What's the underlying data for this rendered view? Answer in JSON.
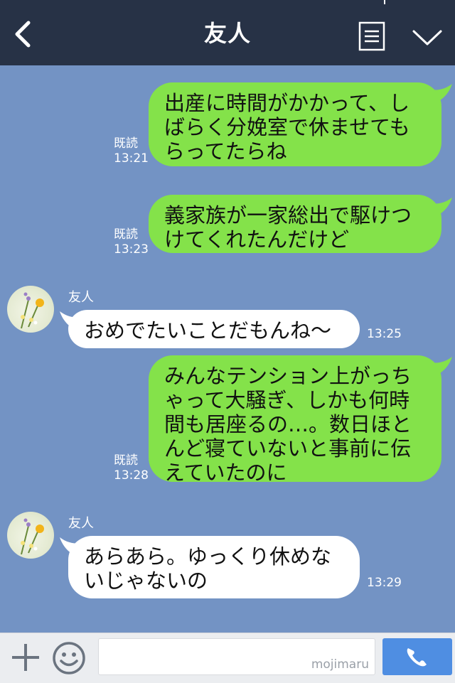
{
  "header": {
    "title": "友人",
    "back_icon": "chevron-left-icon",
    "menu_icon": "notes-icon",
    "expand_icon": "chevron-down-icon"
  },
  "messages": [
    {
      "from": "me",
      "text": "出産に時間がかかって、し\nばらく分娩室で休ませても\nらってたらね",
      "read": "既読",
      "time": "13:21"
    },
    {
      "from": "me",
      "text": "義家族が一家総出で駆けつ\nけてくれたんだけど",
      "read": "既読",
      "time": "13:23"
    },
    {
      "from": "friend",
      "sender": "友人",
      "text": "おめでたいことだもんね〜",
      "time": "13:25"
    },
    {
      "from": "me",
      "text": "みんなテンション上がっち\nゃって大騒ぎ、しかも何時\n間も居座るの…。数日ほと\nんど寝ていないと事前に伝\nえていたのに",
      "read": "既読",
      "time": "13:28"
    },
    {
      "from": "friend",
      "sender": "友人",
      "text": "あらあら。ゆっくり休めな\nいじゃないの",
      "time": "13:29"
    }
  ],
  "footer": {
    "input_value": "",
    "watermark": "mojimaru",
    "plus_icon": "plus-icon",
    "sticker_icon": "smiley-icon",
    "call_icon": "phone-icon"
  },
  "colors": {
    "header_bg": "#273246",
    "chat_bg": "#7393c4",
    "my_bubble": "#84e24a",
    "friend_bubble": "#ffffff",
    "call_button": "#4f8ee2"
  }
}
